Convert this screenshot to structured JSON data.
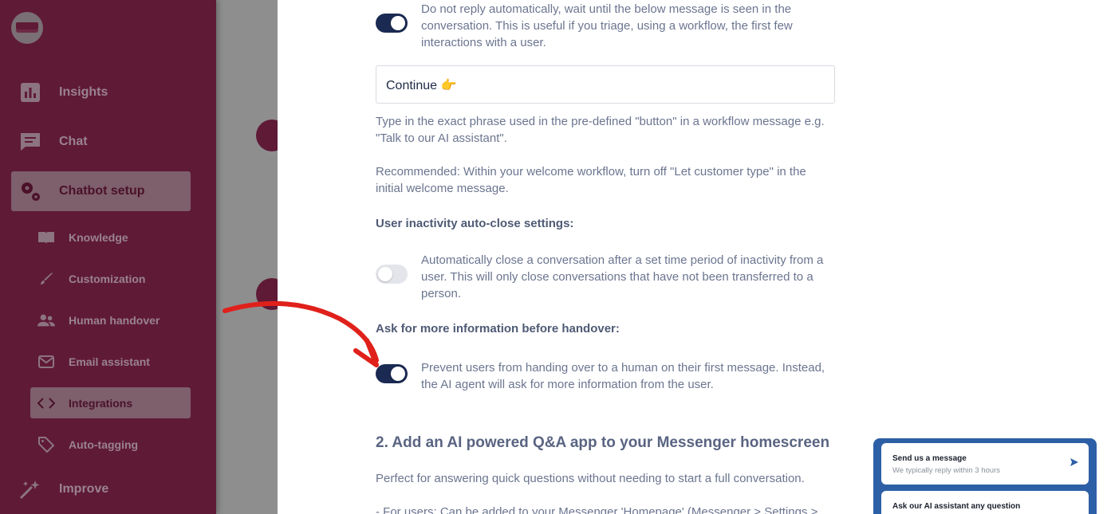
{
  "sidebar": {
    "items": [
      {
        "label": "Insights",
        "icon": "bar-chart-icon"
      },
      {
        "label": "Chat",
        "icon": "chat-icon"
      },
      {
        "label": "Chatbot setup",
        "icon": "gears-icon",
        "active": true
      },
      {
        "label": "Improve",
        "icon": "sparkle-icon"
      }
    ],
    "sub_items": [
      {
        "label": "Knowledge",
        "icon": "book-icon"
      },
      {
        "label": "Customization",
        "icon": "brush-icon"
      },
      {
        "label": "Human handover",
        "icon": "people-icon"
      },
      {
        "label": "Email assistant",
        "icon": "envelope-icon"
      },
      {
        "label": "Integrations",
        "icon": "code-icon",
        "active": true
      },
      {
        "label": "Auto-tagging",
        "icon": "tag-icon"
      }
    ]
  },
  "settings": {
    "wait_seen": {
      "enabled": true,
      "description": "Do not reply automatically, wait until the below message is seen in the conversation. This is useful if you triage, using a workflow, the first few interactions with a user."
    },
    "phrase_input": {
      "value": "Continue 👉"
    },
    "phrase_help": "Type in the exact phrase used in the pre-defined \"button\" in a workflow message e.g. \"Talk to our AI assistant\".",
    "recommended": "Recommended: Within your welcome workflow, turn off \"Let customer type\" in the initial welcome message.",
    "inactivity_label": "User inactivity auto-close settings:",
    "auto_close": {
      "enabled": false,
      "description": "Automatically close a conversation after a set time period of inactivity from a user. This will only close conversations that have not been transferred to a person."
    },
    "more_info_label": "Ask for more information before handover:",
    "prevent_handover": {
      "enabled": true,
      "description": "Prevent users from handing over to a human on their first message. Instead, the AI agent will ask for more information from the user."
    }
  },
  "section2": {
    "heading": "2. Add an AI powered Q&A app to your Messenger homescreen",
    "intro": "Perfect for answering quick questions without needing to start a full conversation.",
    "users_line": "- For users: Can be added to your Messenger 'Homepage' (Messenger > Settings >"
  },
  "messenger_widget": {
    "card1_title": "Send us a message",
    "card1_sub": "We typically reply within 3 hours",
    "card2_title": "Ask our AI assistant any question",
    "accent": "#2d5fa6"
  },
  "colors": {
    "sidebar": "#5f1a36",
    "toggle_on": "#1b2a52",
    "annotation_arrow": "#e0201b"
  }
}
